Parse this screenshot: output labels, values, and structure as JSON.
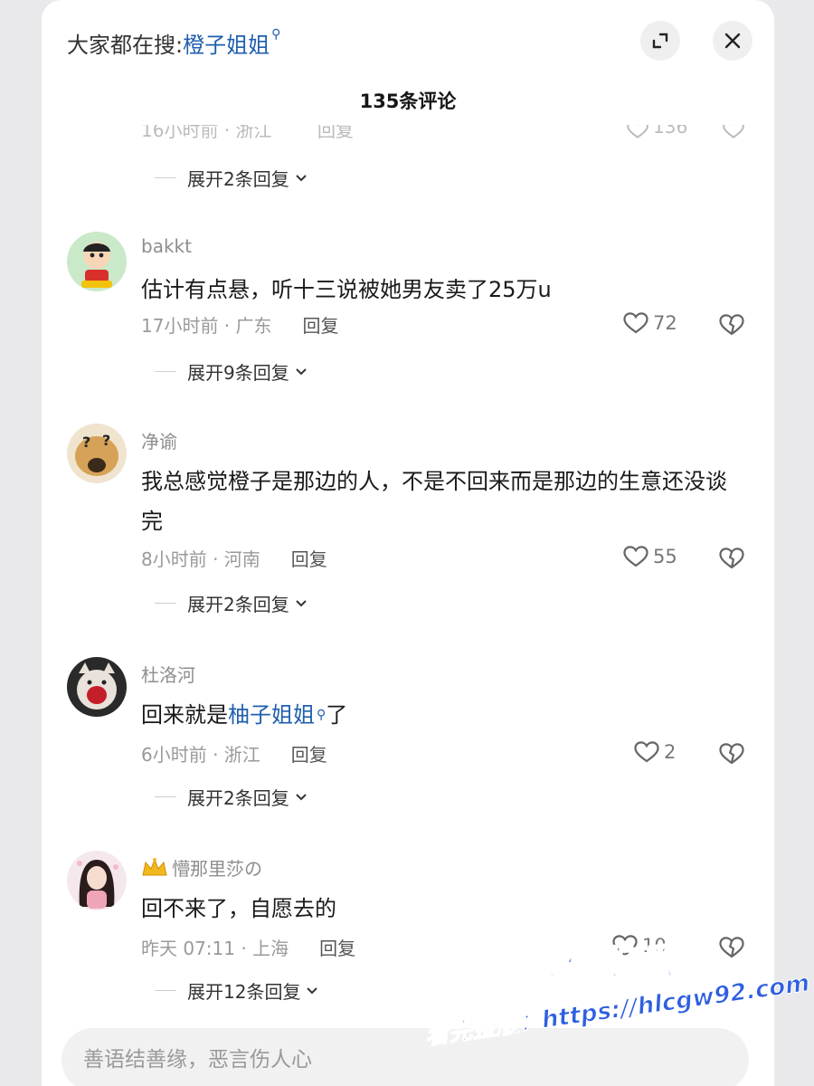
{
  "header": {
    "hot_search_label": "大家都在搜:",
    "hot_search_keyword": "橙子姐姐",
    "comment_count": "135条评论"
  },
  "partial_row": {
    "meta": "16小时前 · 浙江",
    "reply": "回复",
    "likes": "136"
  },
  "comments": [
    {
      "expand_label": "展开2条回复"
    },
    {
      "nickname": "bakkt",
      "text": "估计有点悬，听十三说被她男友卖了25万u",
      "time_location": "17小时前 · 广东",
      "reply_label": "回复",
      "likes": "72",
      "expand_label": "展开9条回复"
    },
    {
      "nickname": "净谕",
      "text": "我总感觉橙子是那边的人，不是不回来而是那边的生意还没谈完",
      "time_location": "8小时前 · 河南",
      "reply_label": "回复",
      "likes": "55",
      "expand_label": "展开2条回复"
    },
    {
      "nickname": "杜洛河",
      "text_before": "回来就是",
      "text_keyword": "柚子姐姐",
      "text_after": "了",
      "time_location": "6小时前 · 浙江",
      "reply_label": "回复",
      "likes": "2",
      "expand_label": "展开2条回复"
    },
    {
      "nickname": "懵那里莎の",
      "text": "回不来了，自愿去的",
      "time_location": "昨天 07:11 · 上海",
      "reply_label": "回复",
      "likes": "10",
      "expand_label": "展开12条回复"
    }
  ],
  "input": {
    "placeholder": "善语结善缘，恶言伤人心"
  },
  "watermark": {
    "title": "黑料吃瓜网",
    "subtitle": "看完整版：https://hlcgw92.com"
  },
  "colors": {
    "keyword": "#1f5fae",
    "watermark": "#2f5fe0"
  },
  "icons": [
    "search-icon",
    "expand-icon",
    "close-icon",
    "heart-icon",
    "broken-heart-icon",
    "chevron-down-icon",
    "crown-icon"
  ]
}
